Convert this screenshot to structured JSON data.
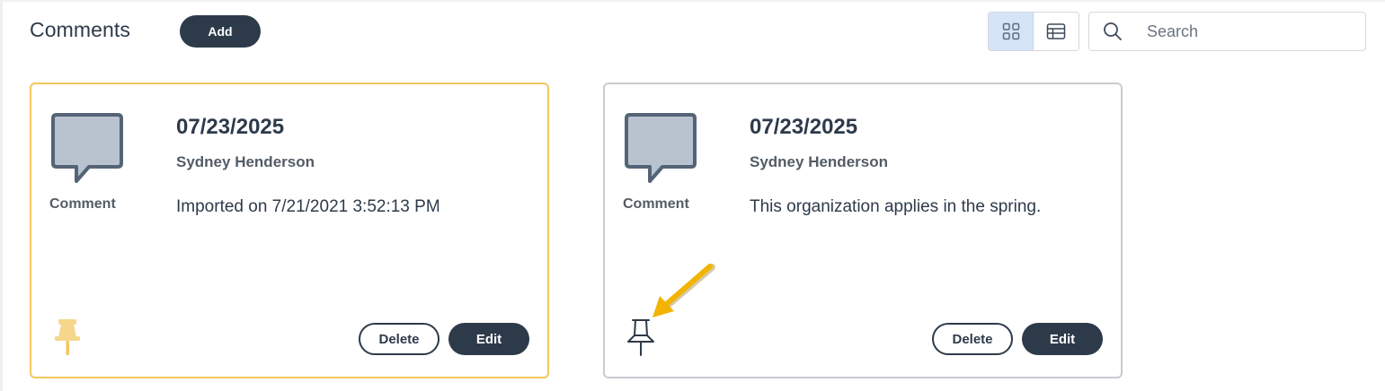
{
  "header": {
    "title": "Comments",
    "add_label": "Add",
    "view_modes": [
      "grid-icon",
      "table-icon"
    ],
    "active_view": "grid",
    "search_placeholder": "Search"
  },
  "colors": {
    "primary": "#2d3a4a",
    "pinned_border": "#f2c75c",
    "pinned_icon": "#f5d68a",
    "annotation_arrow": "#f2b400",
    "active_toggle": "#d6e4f7"
  },
  "cards": [
    {
      "type": "Comment",
      "date": "07/23/2025",
      "author": "Sydney Henderson",
      "text": "Imported on 7/21/2021 3:52:13 PM",
      "pinned": true,
      "delete_label": "Delete",
      "edit_label": "Edit"
    },
    {
      "type": "Comment",
      "date": "07/23/2025",
      "author": "Sydney Henderson",
      "text": "This organization applies in the spring.",
      "pinned": false,
      "delete_label": "Delete",
      "edit_label": "Edit"
    }
  ]
}
